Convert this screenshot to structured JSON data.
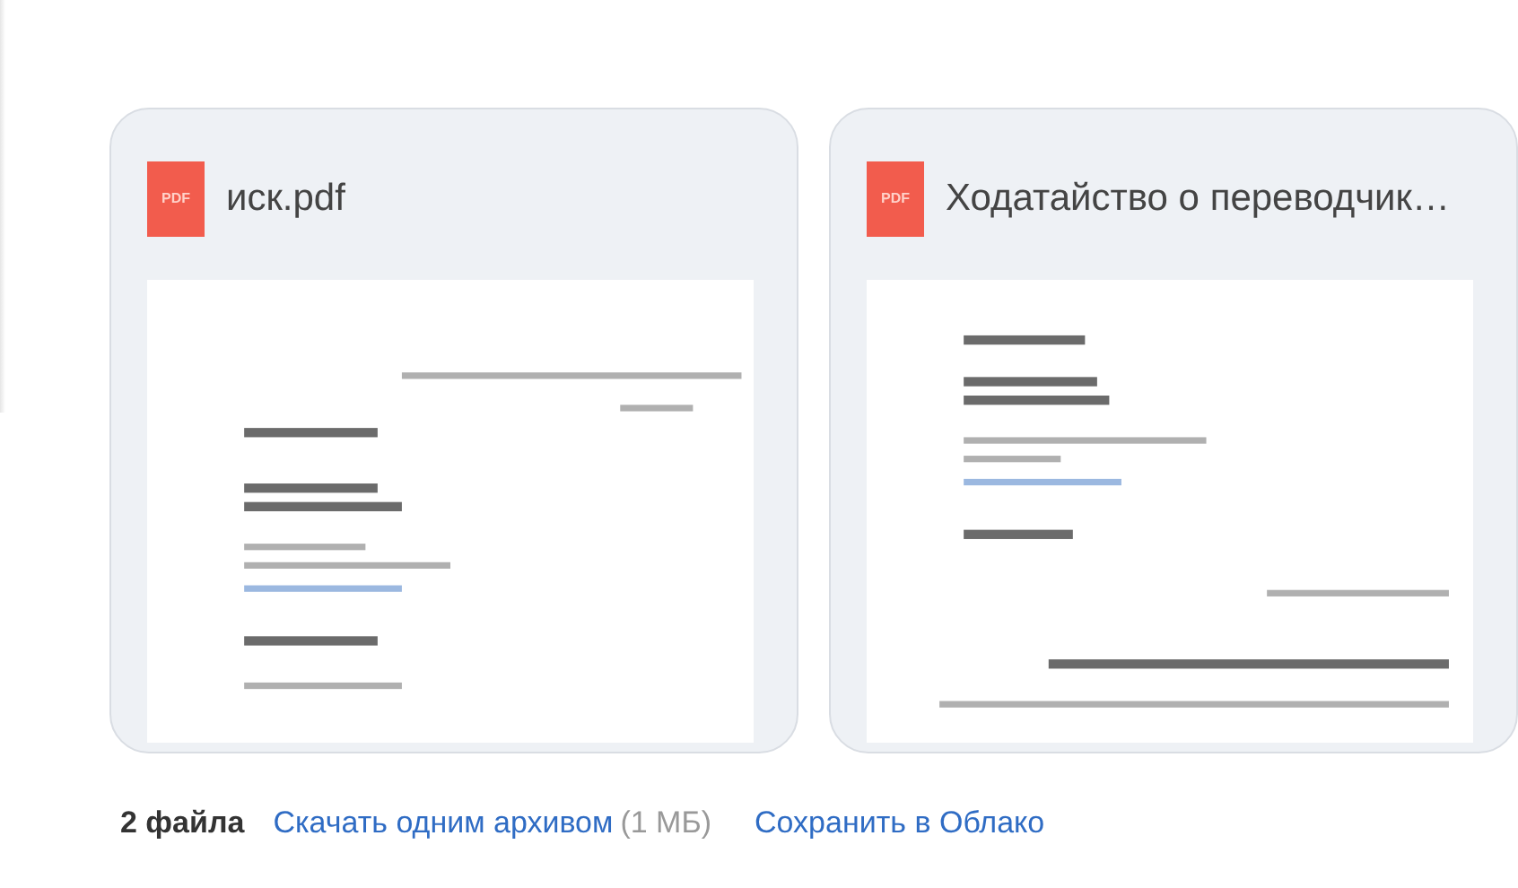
{
  "attachments": [
    {
      "name": "иск.pdf",
      "badge": "PDF"
    },
    {
      "name": "Ходатайство о переводчик…",
      "badge": "PDF"
    }
  ],
  "footer": {
    "count": "2 файла",
    "download_link": "Скачать одним архивом",
    "size": "(1 МБ)",
    "save_link": "Сохранить в Облако"
  }
}
